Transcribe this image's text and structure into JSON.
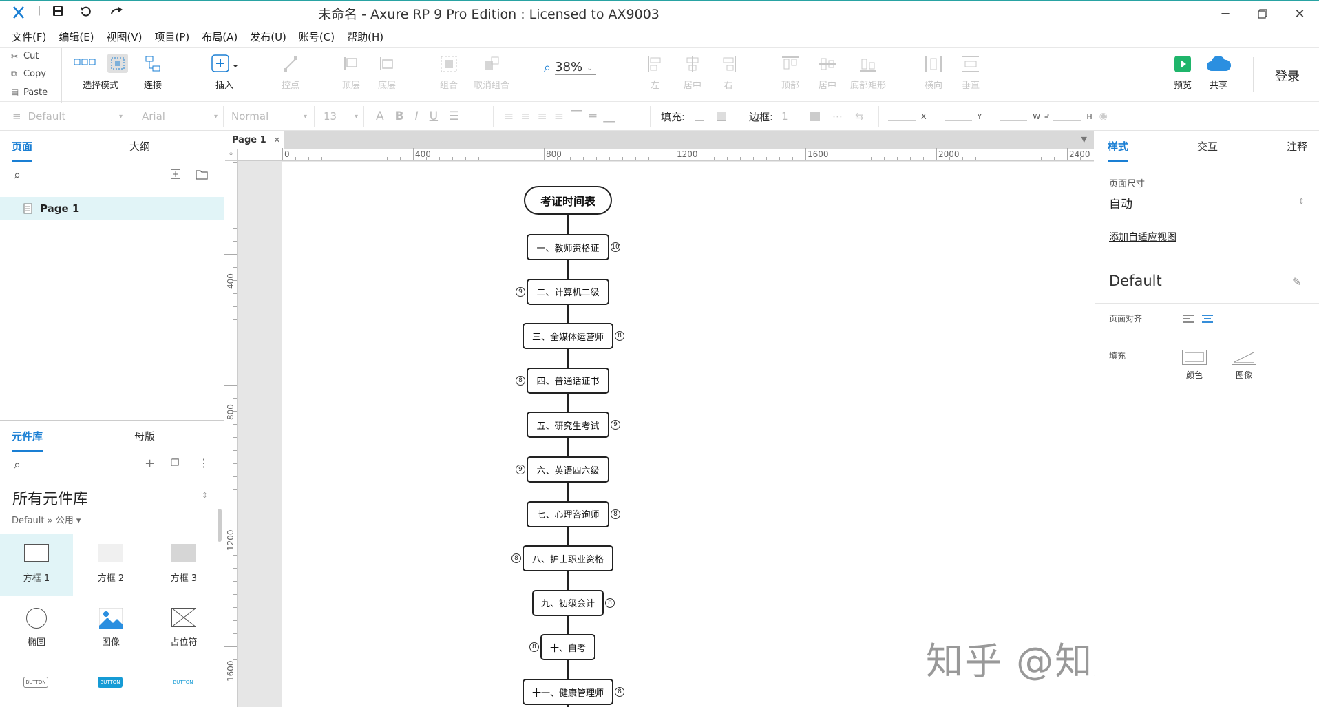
{
  "app": {
    "title": "未命名 - Axure RP 9 Pro Edition : Licensed to AX9003",
    "window_controls": [
      "minimize-icon",
      "restore-icon",
      "close-icon"
    ]
  },
  "menu": [
    "文件(F)",
    "编辑(E)",
    "视图(V)",
    "项目(P)",
    "布局(A)",
    "发布(U)",
    "账号(C)",
    "帮助(H)"
  ],
  "clipboard": {
    "cut": "Cut",
    "copy": "Copy",
    "paste": "Paste"
  },
  "toolbar": {
    "select_mode": "选择模式",
    "connect": "连接",
    "insert": "插入",
    "points": "控点",
    "top": "顶层",
    "bottom": "底层",
    "group": "组合",
    "ungroup": "取消组合",
    "zoom": "38%",
    "left": "左",
    "center": "居中",
    "right": "右",
    "top_align": "顶部",
    "middle": "居中",
    "bottom_align": "底部矩形",
    "horizontal": "横向",
    "vertical": "垂直",
    "preview": "预览",
    "share": "共享",
    "login": "登录"
  },
  "format": {
    "style": "Default",
    "font": "Arial",
    "weight": "Normal",
    "size": "13",
    "fill_label": "填充:",
    "border_label": "边框:",
    "border_width": "1",
    "x_label": "X",
    "y_label": "Y",
    "w_label": "W",
    "h_label": "H"
  },
  "left_panel": {
    "tabs": [
      "页面",
      "大纲"
    ],
    "page_item": "Page 1",
    "lib_tabs": [
      "元件库",
      "母版"
    ],
    "lib_select": "所有元件库",
    "lib_crumb": "Default » 公用 ▾",
    "widgets": [
      "方框 1",
      "方框 2",
      "方框 3",
      "椭圆",
      "图像",
      "占位符"
    ]
  },
  "canvas": {
    "page_tab": "Page 1",
    "hruler_labels": [
      "0",
      "400",
      "800",
      "1200",
      "1600",
      "2000",
      "2400"
    ],
    "vruler_labels": [
      "400",
      "800",
      "1200",
      "1600"
    ],
    "flow_title": "考证时间表",
    "nodes": [
      {
        "label": "一、教师资格证",
        "badge": "10",
        "side": "right"
      },
      {
        "label": "二、计算机二级",
        "badge": "9",
        "side": "left"
      },
      {
        "label": "三、全媒体运营师",
        "badge": "8",
        "side": "right"
      },
      {
        "label": "四、普通话证书",
        "badge": "8",
        "side": "left"
      },
      {
        "label": "五、研究生考试",
        "badge": "9",
        "side": "right"
      },
      {
        "label": "六、英语四六级",
        "badge": "9",
        "side": "left"
      },
      {
        "label": "七、心理咨询师",
        "badge": "8",
        "side": "right"
      },
      {
        "label": "八、护士职业资格",
        "badge": "8",
        "side": "left"
      },
      {
        "label": "九、初级会计",
        "badge": "8",
        "side": "right"
      },
      {
        "label": "十、自考",
        "badge": "8",
        "side": "left"
      },
      {
        "label": "十一、健康管理师",
        "badge": "8",
        "side": "right"
      }
    ],
    "watermark": "知乎 @知犀思维导图"
  },
  "right_panel": {
    "tabs": [
      "样式",
      "交互",
      "注释"
    ],
    "page_size_label": "页面尺寸",
    "page_size_value": "自动",
    "adaptive_link": "添加自适应视图",
    "style_name": "Default",
    "align_label": "页面对齐",
    "fill_label": "填充",
    "fill_color": "颜色",
    "fill_image": "图像"
  },
  "colors": {
    "accent": "#1a7fd4",
    "selected_bg": "#e1f4f7",
    "preview_green": "#1fb56b",
    "share_blue": "#2b8fe0"
  }
}
